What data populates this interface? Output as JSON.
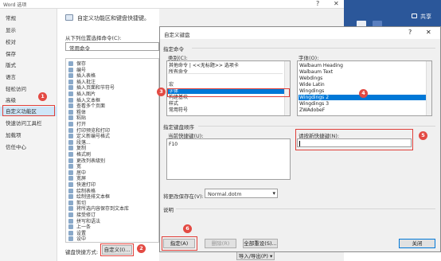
{
  "outer_window": {
    "title": "Word 选项",
    "help": "?",
    "close": "✕"
  },
  "left_nav": {
    "items": [
      {
        "label": "常规"
      },
      {
        "label": "显示"
      },
      {
        "label": "校对"
      },
      {
        "label": "保存"
      },
      {
        "label": "版式"
      },
      {
        "label": "语言"
      },
      {
        "label": "轻松访问"
      },
      {
        "label": "高级"
      },
      {
        "label": "自定义功能区"
      },
      {
        "label": "快速访问工具栏"
      },
      {
        "label": "加载项"
      },
      {
        "label": "信任中心"
      }
    ]
  },
  "main": {
    "heading": "自定义功能区和键盘快捷键。",
    "choose_label": "从下列位置选择命令(C):",
    "choose_value": "常用命令",
    "commands": [
      "保存",
      "编号",
      "插入表格",
      "插入批注",
      "插入页面和节符号",
      "插入图片",
      "插入文本框",
      "查看多个页面",
      "粗体",
      "粘贴",
      "打开",
      "打印预览和打印",
      "定义新编号格式",
      "段落...",
      "复制",
      "格式刷",
      "更改列表级别",
      "宽",
      "居中",
      "宽屏",
      "快速打印",
      "绘制表格",
      "绘制竖排文本框",
      "剪切",
      "将所选内容保存到文本库",
      "接受修订",
      "拼写和语法",
      "上一条",
      "设置",
      "设中"
    ],
    "keyboard_label": "键盘快捷方式:",
    "customize_button": "自定义(I)...",
    "import_export": "导入/导出(P) ▾"
  },
  "dialog": {
    "title": "自定义键盘",
    "help": "?",
    "close": "✕",
    "specify_command": "指定命令",
    "categories_label": "类别(C):",
    "categories": [
      "其他命令 | <<无标题>> 选项卡",
      "所有命令",
      "",
      "宏",
      "字体",
      "构建基块",
      "样式",
      "常用符号"
    ],
    "categories_selected": 4,
    "fonts_label": "字体(O):",
    "fonts": [
      "Walbaum Heading",
      "Walbaum Text",
      "Webdings",
      "Wide Latin",
      "Wingdings",
      "Wingdings 2",
      "Wingdings 3",
      "ZWAdobeF"
    ],
    "fonts_selected": 5,
    "specify_keys": "指定键盘顺序",
    "current_keys_label": "当前快捷键(U):",
    "current_keys": [
      "F10"
    ],
    "new_key_label": "请按新快捷键(N):",
    "new_key_value": "",
    "save_in_label": "将更改保存在(V):",
    "save_in_value": "Normal.dotm",
    "description_label": "说明",
    "assign_button": "指定(A)",
    "remove_button": "删除(R)",
    "reset_all_button": "全部重设(S)...",
    "close_button": "关闭"
  },
  "word_window": {
    "share": "共享",
    "help": "?"
  },
  "badges": [
    "1",
    "2",
    "3",
    "4",
    "5",
    "6"
  ],
  "colors": {
    "accent": "#0078d7",
    "highlight_box": "#e0403a",
    "badge": "#e34a43",
    "word_blue": "#2b579a"
  }
}
